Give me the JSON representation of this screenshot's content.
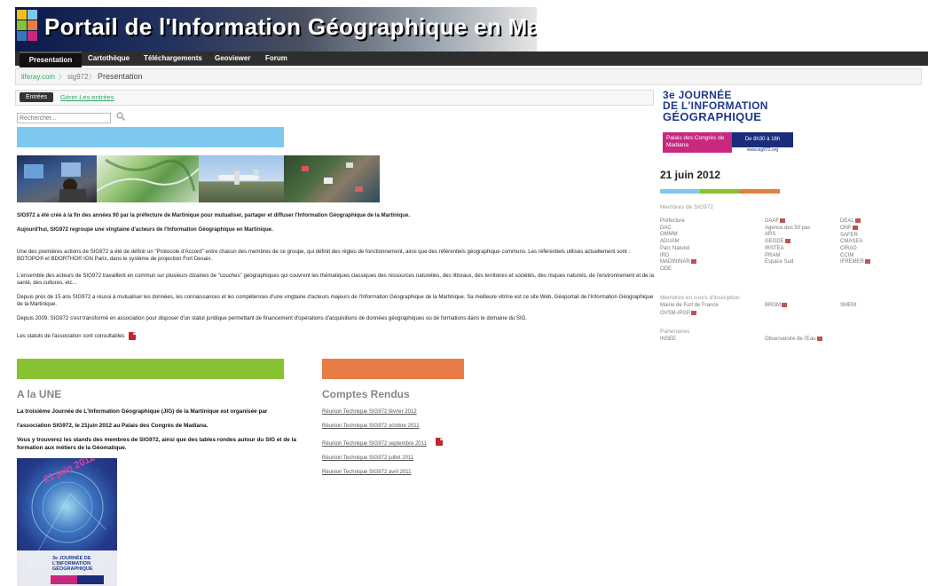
{
  "banner": {
    "title": "Portail de l'Information Géographique en Martinique"
  },
  "nav": [
    "Presentation",
    "Cartothèque",
    "Téléchargements",
    "Geoviewer",
    "Forum"
  ],
  "breadcrumb": [
    "liferay.com",
    "sig972",
    "Presentation"
  ],
  "entries": {
    "active_tab": "Entrées",
    "manage_link": "Gérer Les entrées"
  },
  "search": {
    "placeholder": "Rechercher..."
  },
  "intro": {
    "p1": "SIG972 a été créé à la fin des années 90 par la préfecture de Martinique pour mutualiser, partager et diffuser l'Information Géographique de la Martinique.",
    "p2": "Aujourd'hui, SIG972 regroupe une vingtaine d'acteurs de l'Information Géographique en Martinique.",
    "p3": "Une des premières actions de SIG972 a été de définir un \"Protocole d'Accord\" entre chacun des membres de ce groupe, qui définit des règles de fonctionnement, ainsi que des référentiels géographique communs. Les référentiels utilisés actuellement sont : BDTOPO® et BDORTHO® IGN Paris, dans le système de projection Fort Desaix.",
    "p4": "L'ensemble des acteurs de SIG972 travaillent en commun sur plusieurs dizaines de \"couches\" géographiques qui couvrent les thématiques classiques des ressources naturelles, des littoraux, des territoires et sociétés, des risques naturels, de l'environnement et de la santé, des cultures, etc...",
    "p5": "Depuis près de 15 ans SIG972 a réussi à mutualiser les données, les connaissances et les compétences d'une vingtaine d'acteurs majeurs de l'Information Géographique de la Martinique. Sa meilleure vitrine est ce site Web, Géoportail de l'Information Géographique de la Martinique.",
    "p6": "Depuis 2009, SIG972 s'est transformé en association pour disposer d'un statut juridique permettant de financement d'opérations d'acquisitions de données géographiques ou de formations dans le domaine du SIG.",
    "p7": "Les statuts de l'association sont consultables"
  },
  "une": {
    "title": "A la UNE",
    "l1": "La troisième Journée de L'Information Géographique (JIG) de la Martinique est organisée par",
    "l2": "l'association SIG972, le 21juin 2012 au Palais des Congrès de Madiana.",
    "l3": "Vous y trouverez les stands des membres de SIG972, ainsi que des tables rondes autour du SIG et de la formation aux métiers de la Géomatique."
  },
  "poster": {
    "date": "21 juin 2012",
    "jig": "3e JOURNÉE DE L'INFORMATION GÉOGRAPHIQUE"
  },
  "comptes": {
    "title": "Comptes Rendus",
    "items": [
      "Réunion Technique SIG972 février 2012",
      "Réunion Technique SIG972 octobre 2011",
      "Réunion Technique SIG972 septembre 2011",
      "Réunion Technique SIG972 juillet 2011",
      "Réunion Technique SIG972 avril 2011"
    ]
  },
  "jig": {
    "title_l1": "3e JOURNÉE",
    "title_l2": "DE L'INFORMATION",
    "title_l3": "GÉOGRAPHIQUE",
    "palais": "Palais des Congrès de Madiana",
    "hours": "De 8h30 à 16h",
    "url": "www.sig972.org",
    "date": "21 juin 2012"
  },
  "members": {
    "title": "Membres de SIG972",
    "col1": [
      "Préfecture",
      "DAC",
      "OMMM",
      "ADUAM",
      "Parc Naturel",
      "IRD",
      "MADININAR",
      "ODE"
    ],
    "col2": [
      "DAAF",
      "Agence des 50 pas",
      "ARS",
      "GEODE",
      "IRSTEA",
      "PRAM",
      "Espace Sud"
    ],
    "col3": [
      "DEAL",
      "ONF",
      "SAFER",
      "CMASEA",
      "CIRAD",
      "CCIM",
      "IFREMER"
    ]
  },
  "pending": {
    "title": "Membres en cours d'inscription",
    "items": [
      "Mairie de Fort de France",
      "BRGM",
      "SMEM",
      "OVSM-IPGP"
    ]
  },
  "partners": {
    "title": "Partenaires",
    "items": [
      "INSEE",
      "Observatoire de l'Eau"
    ]
  },
  "colors": {
    "blue": "#7dc8ef",
    "green": "#86c232",
    "orange": "#e87c45",
    "nav": "#2e2e2e"
  }
}
